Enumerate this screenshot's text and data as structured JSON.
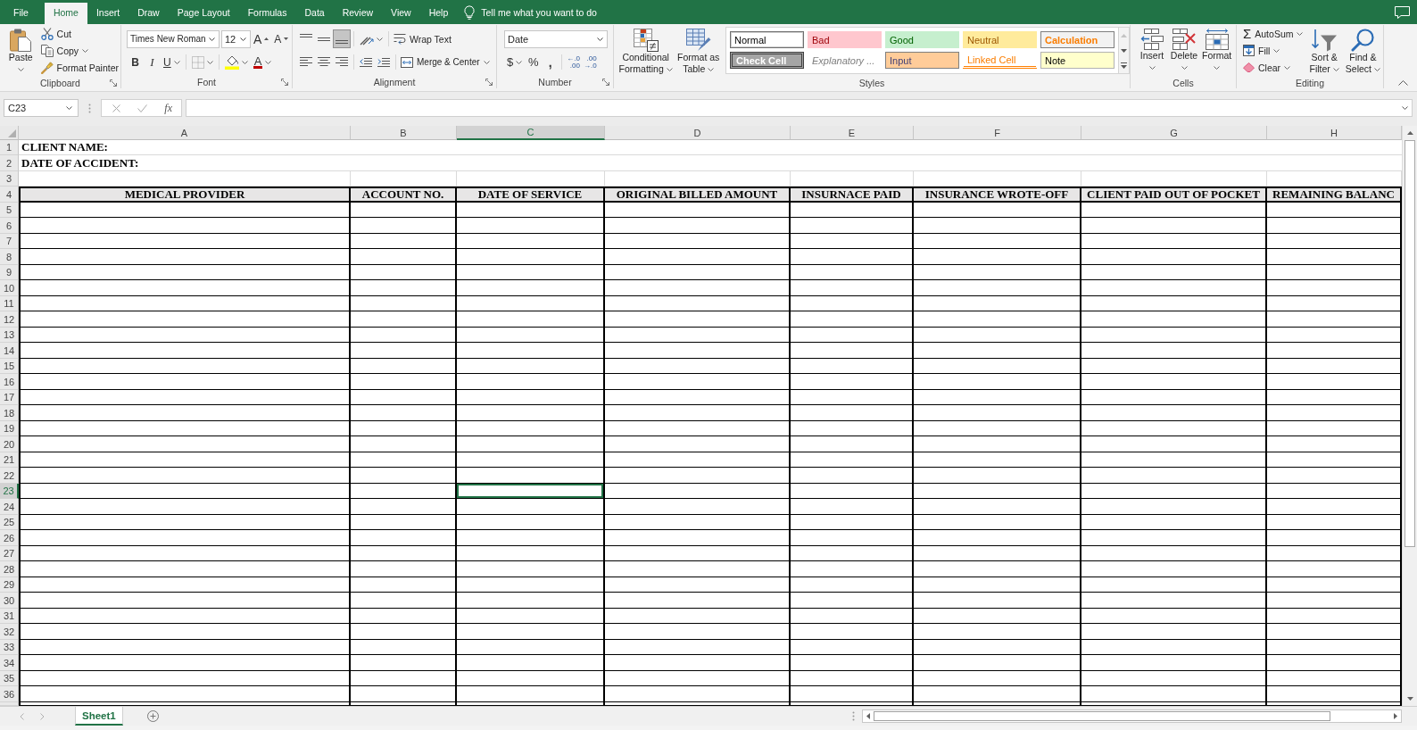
{
  "ribbon_tabs": [
    {
      "label": "File",
      "selected": false
    },
    {
      "label": "Home",
      "selected": true
    },
    {
      "label": "Insert",
      "selected": false
    },
    {
      "label": "Draw",
      "selected": false
    },
    {
      "label": "Page Layout",
      "selected": false
    },
    {
      "label": "Formulas",
      "selected": false
    },
    {
      "label": "Data",
      "selected": false
    },
    {
      "label": "Review",
      "selected": false
    },
    {
      "label": "View",
      "selected": false
    },
    {
      "label": "Help",
      "selected": false
    }
  ],
  "tell_me": {
    "placeholder": "Tell me what you want to do"
  },
  "ribbon": {
    "clipboard": {
      "label": "Clipboard",
      "paste": "Paste",
      "cut": "Cut",
      "copy": "Copy",
      "format_painter": "Format Painter"
    },
    "font": {
      "label": "Font",
      "font_name": "Times New Roman",
      "font_size": "12",
      "grow_font": "A",
      "shrink_font": "A",
      "bold": "B",
      "italic": "I",
      "underline": "U",
      "font_color": "A"
    },
    "alignment": {
      "label": "Alignment",
      "vertical_align": [
        {
          "kind": "top",
          "selected": false
        },
        {
          "kind": "middle",
          "selected": false
        },
        {
          "kind": "bottom",
          "selected": true
        }
      ],
      "horizontal_align": [
        {
          "kind": "left",
          "selected": false
        },
        {
          "kind": "center",
          "selected": false
        },
        {
          "kind": "right",
          "selected": false
        }
      ],
      "wrap_text": "Wrap Text",
      "merge_center": "Merge & Center"
    },
    "number": {
      "label": "Number",
      "format": "Date",
      "currency": "$",
      "percent": "%",
      "comma": ",",
      "increase_decimal": [
        "←.0",
        ".00"
      ],
      "decrease_decimal": [
        ".00",
        "→.0"
      ]
    },
    "styles": {
      "label": "Styles",
      "conditional_formatting": [
        "Conditional",
        "Formatting"
      ],
      "format_as_table": [
        "Format as",
        "Table"
      ],
      "cell_styles": [
        {
          "name": "Normal",
          "kind": "normal",
          "selected": true
        },
        {
          "name": "Bad",
          "kind": "bad",
          "selected": false
        },
        {
          "name": "Good",
          "kind": "good",
          "selected": false
        },
        {
          "name": "Neutral",
          "kind": "neutral",
          "selected": false
        },
        {
          "name": "Calculation",
          "kind": "calculation",
          "selected": false
        },
        {
          "name": "Check Cell",
          "kind": "check",
          "selected": false
        },
        {
          "name": "Explanatory ...",
          "kind": "explanatory",
          "selected": false
        },
        {
          "name": "Input",
          "kind": "input",
          "selected": false
        },
        {
          "name": "Linked Cell",
          "kind": "linked",
          "selected": false
        },
        {
          "name": "Note",
          "kind": "note",
          "selected": false
        }
      ]
    },
    "cells": {
      "label": "Cells",
      "buttons": [
        {
          "kind": "insert",
          "label": "Insert"
        },
        {
          "kind": "delete",
          "label": "Delete"
        },
        {
          "kind": "format",
          "label": "Format"
        }
      ]
    },
    "editing": {
      "label": "Editing",
      "autosum_symbol": "Σ",
      "autosum": "AutoSum",
      "fill": "Fill",
      "clear": "Clear",
      "sort_filter": [
        "Sort &",
        "Filter"
      ],
      "find_select": [
        "Find &",
        "Select"
      ]
    }
  },
  "formula_bar": {
    "name_box": "C23",
    "function_button": "fx"
  },
  "sheet": {
    "columns": [
      {
        "label": "A",
        "selected": false
      },
      {
        "label": "B",
        "selected": false
      },
      {
        "label": "C",
        "selected": true
      },
      {
        "label": "D",
        "selected": false
      },
      {
        "label": "E",
        "selected": false
      },
      {
        "label": "F",
        "selected": false
      },
      {
        "label": "G",
        "selected": false
      },
      {
        "label": "H",
        "selected": false
      }
    ],
    "rows": [
      {
        "number": "1",
        "selected": false,
        "kind": "title",
        "text": "CLIENT NAME:"
      },
      {
        "number": "2",
        "selected": false,
        "kind": "title",
        "text": "DATE OF ACCIDENT:"
      },
      {
        "number": "3",
        "selected": false,
        "kind": "blank"
      },
      {
        "number": "4",
        "selected": false,
        "kind": "header",
        "cells": [
          "MEDICAL PROVIDER",
          "ACCOUNT NO.",
          "DATE OF SERVICE",
          "ORIGINAL BILLED AMOUNT",
          "INSURNACE PAID",
          "INSURANCE WROTE-OFF",
          "CLIENT PAID OUT OF POCKET",
          "REMAINING BALANC"
        ]
      },
      {
        "number": "5",
        "selected": false,
        "kind": "entry"
      },
      {
        "number": "6",
        "selected": false,
        "kind": "entry"
      },
      {
        "number": "7",
        "selected": false,
        "kind": "entry"
      },
      {
        "number": "8",
        "selected": false,
        "kind": "entry"
      },
      {
        "number": "9",
        "selected": false,
        "kind": "entry"
      },
      {
        "number": "10",
        "selected": false,
        "kind": "entry"
      },
      {
        "number": "11",
        "selected": false,
        "kind": "entry"
      },
      {
        "number": "12",
        "selected": false,
        "kind": "entry"
      },
      {
        "number": "13",
        "selected": false,
        "kind": "entry"
      },
      {
        "number": "14",
        "selected": false,
        "kind": "entry"
      },
      {
        "number": "15",
        "selected": false,
        "kind": "entry"
      },
      {
        "number": "16",
        "selected": false,
        "kind": "entry"
      },
      {
        "number": "17",
        "selected": false,
        "kind": "entry"
      },
      {
        "number": "18",
        "selected": false,
        "kind": "entry"
      },
      {
        "number": "19",
        "selected": false,
        "kind": "entry"
      },
      {
        "number": "20",
        "selected": false,
        "kind": "entry"
      },
      {
        "number": "21",
        "selected": false,
        "kind": "entry"
      },
      {
        "number": "22",
        "selected": false,
        "kind": "entry"
      },
      {
        "number": "23",
        "selected": true,
        "kind": "entry"
      },
      {
        "number": "24",
        "selected": false,
        "kind": "entry"
      },
      {
        "number": "25",
        "selected": false,
        "kind": "entry"
      },
      {
        "number": "26",
        "selected": false,
        "kind": "entry"
      },
      {
        "number": "27",
        "selected": false,
        "kind": "entry"
      },
      {
        "number": "28",
        "selected": false,
        "kind": "entry"
      },
      {
        "number": "29",
        "selected": false,
        "kind": "entry"
      },
      {
        "number": "30",
        "selected": false,
        "kind": "entry"
      },
      {
        "number": "31",
        "selected": false,
        "kind": "entry"
      },
      {
        "number": "32",
        "selected": false,
        "kind": "entry"
      },
      {
        "number": "33",
        "selected": false,
        "kind": "entry"
      },
      {
        "number": "34",
        "selected": false,
        "kind": "entry"
      },
      {
        "number": "35",
        "selected": false,
        "kind": "entry"
      },
      {
        "number": "36",
        "selected": false,
        "kind": "entry"
      }
    ]
  },
  "sheet_tabs": [
    {
      "label": "Sheet1",
      "selected": true
    }
  ]
}
